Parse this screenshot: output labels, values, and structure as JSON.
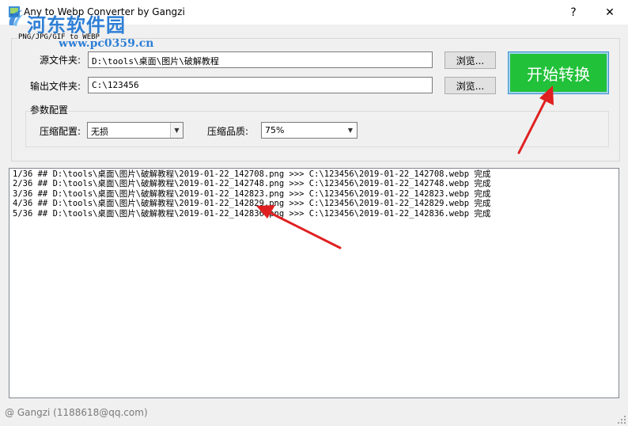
{
  "window": {
    "title": "Any to Webp Converter by Gangzi",
    "help_glyph": "?",
    "close_glyph": "✕"
  },
  "watermark": {
    "name": "河东软件园",
    "url": "www.pc0359.cn"
  },
  "group": {
    "caption": "PNG/JPG/GIF to WEBP"
  },
  "source": {
    "label": "源文件夹:",
    "value": "D:\\tools\\桌面\\图片\\破解教程",
    "browse_label": "浏览..."
  },
  "output": {
    "label": "输出文件夹:",
    "value": "C:\\123456",
    "browse_label": "浏览..."
  },
  "start_button": {
    "label": "开始转换",
    "color": "#22c13a"
  },
  "params": {
    "caption": "参数配置",
    "compression_label": "压缩配置:",
    "compression_value": "无损",
    "quality_label": "压缩品质:",
    "quality_value": "75%"
  },
  "log": {
    "lines": [
      "1/36 ## D:\\tools\\桌面\\图片\\破解教程\\2019-01-22_142708.png >>> C:\\123456\\2019-01-22_142708.webp 完成",
      "2/36 ## D:\\tools\\桌面\\图片\\破解教程\\2019-01-22_142748.png >>> C:\\123456\\2019-01-22_142748.webp 完成",
      "3/36 ## D:\\tools\\桌面\\图片\\破解教程\\2019-01-22_142823.png >>> C:\\123456\\2019-01-22_142823.webp 完成",
      "4/36 ## D:\\tools\\桌面\\图片\\破解教程\\2019-01-22_142829.png >>> C:\\123456\\2019-01-22_142829.webp 完成",
      "5/36 ## D:\\tools\\桌面\\图片\\破解教程\\2019-01-22_142836.png >>> C:\\123456\\2019-01-22_142836.webp 完成"
    ]
  },
  "status": {
    "text": "@ Gangzi (1188618@qq.com)"
  },
  "annotations": {
    "arrow_color": "#e02020"
  }
}
